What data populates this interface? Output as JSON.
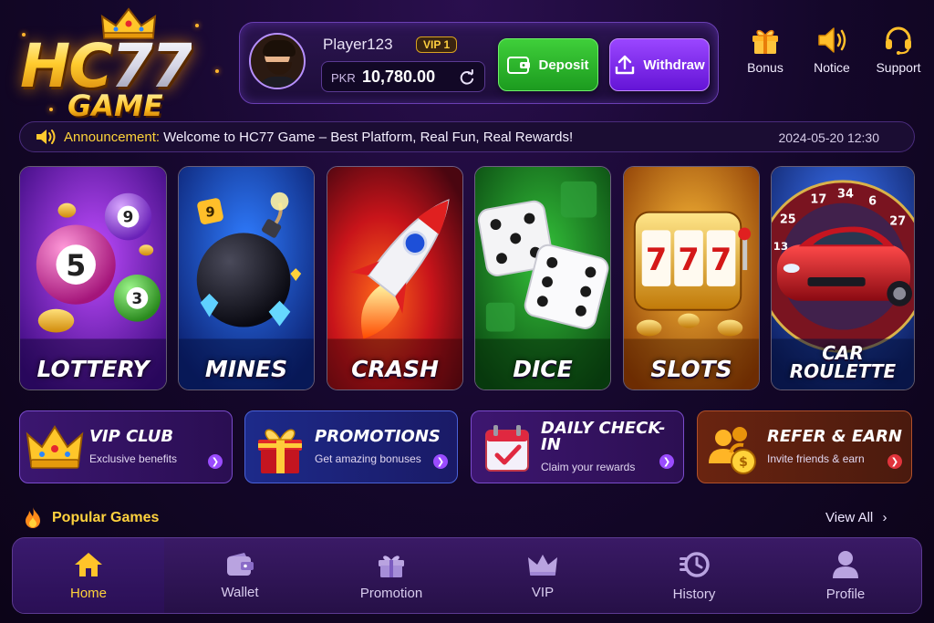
{
  "brand": {
    "logo_main_a": "HC",
    "logo_main_b": "77",
    "logo_sub": "GAME"
  },
  "account": {
    "player_name": "Player123",
    "vip_label": "VIP 1",
    "currency": "PKR",
    "balance": "10,780.00",
    "deposit_label": "Deposit",
    "withdraw_label": "Withdraw"
  },
  "top_actions": [
    {
      "label": "Bonus",
      "icon": "gift-icon"
    },
    {
      "label": "Notice",
      "icon": "speaker-icon"
    },
    {
      "label": "Support",
      "icon": "headset-icon"
    }
  ],
  "announcement": {
    "title": "Announcement:",
    "text": "Welcome to HC77 Game – Best Platform, Real Fun, Real Rewards!",
    "datetime": "2024-05-20 12:30"
  },
  "games": [
    {
      "title": "LOTTERY",
      "color": "#7a1fd6"
    },
    {
      "title": "MINES",
      "color": "#1a4fc7"
    },
    {
      "title": "CRASH",
      "color": "#c0181a"
    },
    {
      "title": "DICE",
      "color": "#1f8e2a"
    },
    {
      "title": "SLOTS",
      "color": "#d9780a"
    },
    {
      "title": "CAR ROULETTE",
      "color": "#2649a8"
    }
  ],
  "features": [
    {
      "title": "VIP CLUB",
      "subtitle": "Exclusive benefits"
    },
    {
      "title": "PROMOTIONS",
      "subtitle": "Get amazing bonuses"
    },
    {
      "title": "DAILY CHECK-IN",
      "subtitle": "Claim your rewards"
    },
    {
      "title": "REFER & EARN",
      "subtitle": "Invite friends & earn"
    }
  ],
  "popular": {
    "title": "Popular Games",
    "view_all": "View All"
  },
  "roulette_numbers": [
    "25",
    "17",
    "34",
    "6",
    "27",
    "13"
  ],
  "lottery_balls": [
    "9",
    "5",
    "3"
  ],
  "nav": [
    {
      "label": "Home",
      "icon": "home-icon",
      "active": true
    },
    {
      "label": "Wallet",
      "icon": "wallet-icon",
      "active": false
    },
    {
      "label": "Promotion",
      "icon": "gift-icon",
      "active": false
    },
    {
      "label": "VIP",
      "icon": "crown-icon",
      "active": false
    },
    {
      "label": "History",
      "icon": "history-icon",
      "active": false
    },
    {
      "label": "Profile",
      "icon": "profile-icon",
      "active": false
    }
  ],
  "colors": {
    "accent_gold": "#ffd23a",
    "deposit_green": "#1c9b1f",
    "withdraw_purple": "#6414d6",
    "background": "#14072a"
  }
}
